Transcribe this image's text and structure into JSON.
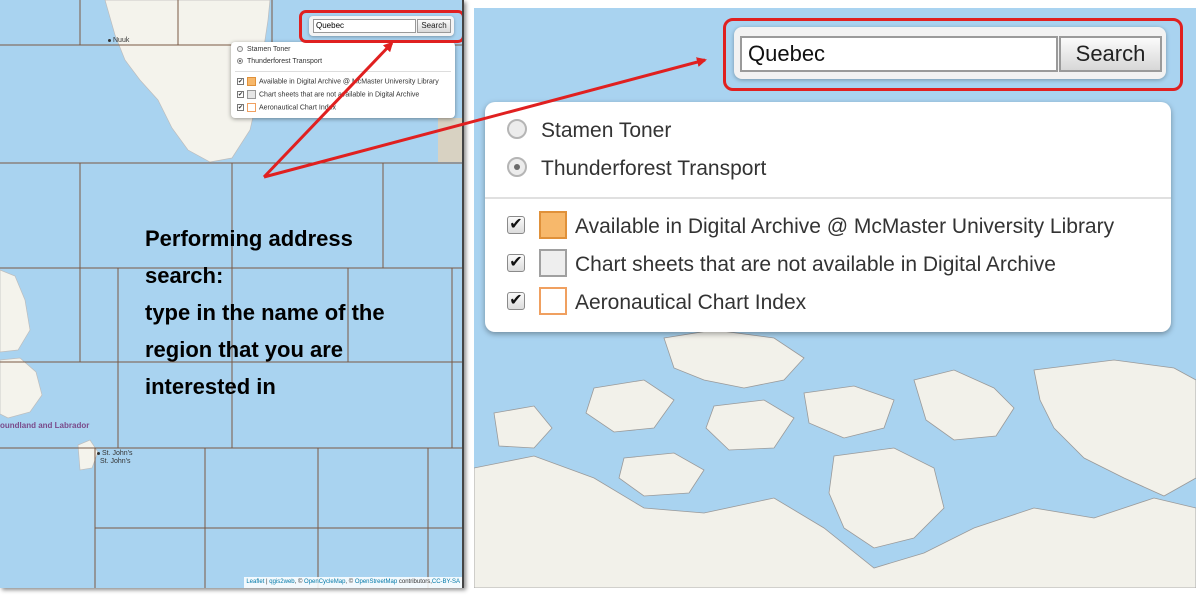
{
  "left_map": {
    "cities": [
      {
        "name": "Nuuk"
      },
      {
        "name": "St. John's"
      },
      {
        "name": "St. John's"
      }
    ],
    "province_label": "oundland and Labrador",
    "search": {
      "value": "Quebec",
      "button_label": "Search"
    },
    "layers": {
      "basemaps": [
        {
          "label": "Stamen Toner",
          "selected": false
        },
        {
          "label": "Thunderforest Transport",
          "selected": true
        }
      ],
      "overlays": [
        {
          "label": "Available in Digital Archive @ McMaster University Library",
          "checked": true,
          "swatch_color": "#f7b86b"
        },
        {
          "label": "Chart sheets that are not available in Digital Archive",
          "checked": true,
          "swatch_color": "#e6e6e6"
        },
        {
          "label": "Aeronautical Chart Index",
          "checked": true,
          "swatch_color": "#ffffff"
        }
      ]
    },
    "attribution": {
      "leaflet": "Leaflet",
      "separator": " | ",
      "qgis2web": "qgis2web",
      "ocm_prefix": ", © ",
      "ocm": "OpenCycleMap",
      "osm_prefix": ", © ",
      "osm": "OpenStreetMap",
      "contributors": " contributors,",
      "license": "CC-BY-SA"
    }
  },
  "instruction_text": "Performing address search:\ntype in the name of the region that you are interested in",
  "right_zoom": {
    "search": {
      "value": "Quebec",
      "button_label": "Search"
    },
    "layers": {
      "basemaps": [
        {
          "label": "Stamen Toner",
          "selected": false
        },
        {
          "label": "Thunderforest Transport",
          "selected": true
        }
      ],
      "overlays": [
        {
          "label": "Available in Digital Archive @ McMaster University Library",
          "checked": true,
          "swatch_color": "#f7b86b",
          "swatch_border": "#e0913a"
        },
        {
          "label": "Chart sheets that are not available in Digital Archive",
          "checked": true,
          "swatch_color": "#eeeeee",
          "swatch_border": "#9a9a9a"
        },
        {
          "label": "Aeronautical Chart Index",
          "checked": true,
          "swatch_color": "#ffffff",
          "swatch_border": "#f0a060"
        }
      ]
    }
  },
  "colors": {
    "highlight_red": "#e02020",
    "water": "#a9d3f0",
    "land": "#f2f1ea",
    "grid": "#7a5a44"
  },
  "icons": {
    "radio": "radio-button-icon",
    "checkbox": "checkbox-icon",
    "arrow": "annotation-arrow-icon",
    "city": "city-dot-icon"
  }
}
